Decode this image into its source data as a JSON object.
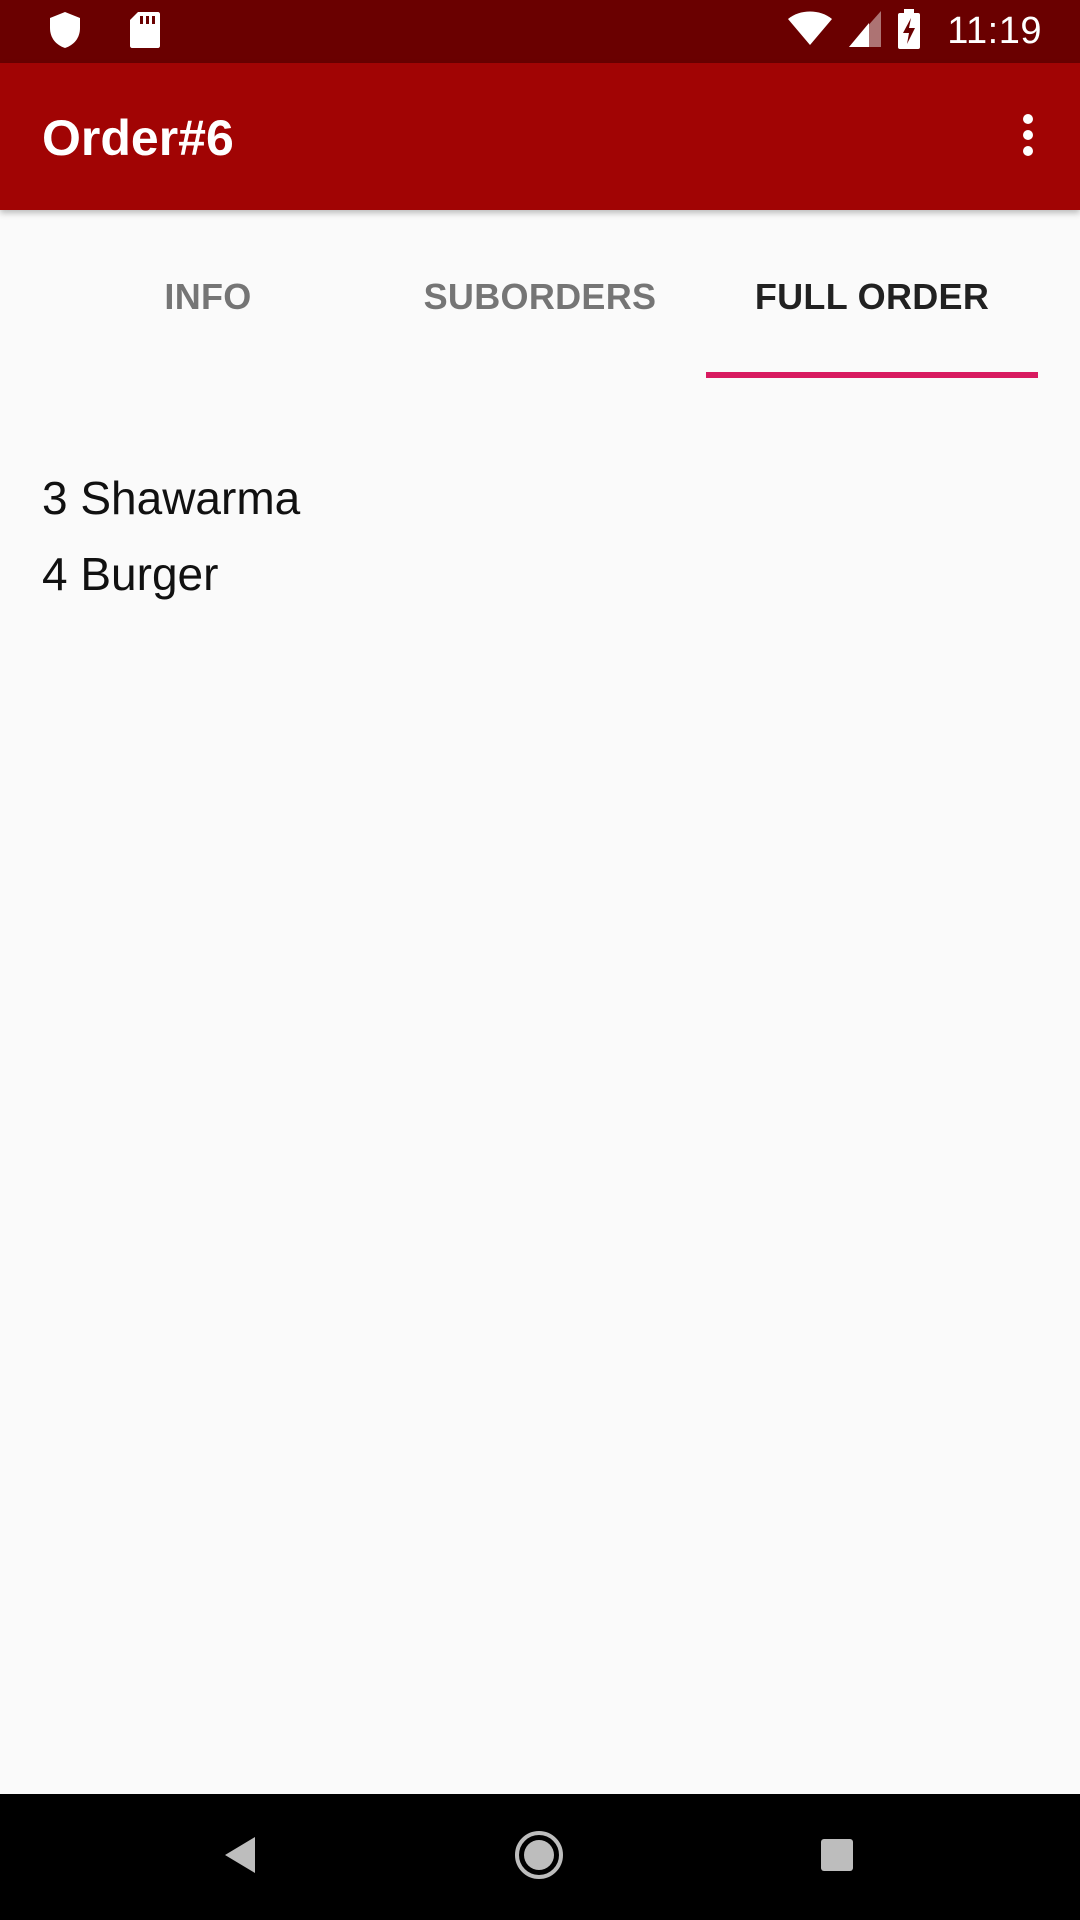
{
  "status_bar": {
    "time": "11:19",
    "left_icons": [
      "shield-icon",
      "sd-card-icon"
    ],
    "right_icons": [
      "wifi-icon",
      "cell-signal-icon",
      "battery-charging-icon"
    ]
  },
  "app_bar": {
    "title": "Order#6",
    "overflow_icon": "more-vert-icon"
  },
  "tabs": [
    {
      "label": "INFO",
      "active": false
    },
    {
      "label": "SUBORDERS",
      "active": false
    },
    {
      "label": "FULL ORDER",
      "active": true
    }
  ],
  "full_order": {
    "items": [
      "3 Shawarma",
      "4 Burger"
    ]
  },
  "nav_bar": {
    "buttons": [
      "back-icon",
      "home-icon",
      "recents-icon"
    ]
  },
  "colors": {
    "status_bar": "#6A0000",
    "app_bar": "#A10404",
    "tab_indicator": "#D81B60",
    "background": "#FAFAFA"
  }
}
